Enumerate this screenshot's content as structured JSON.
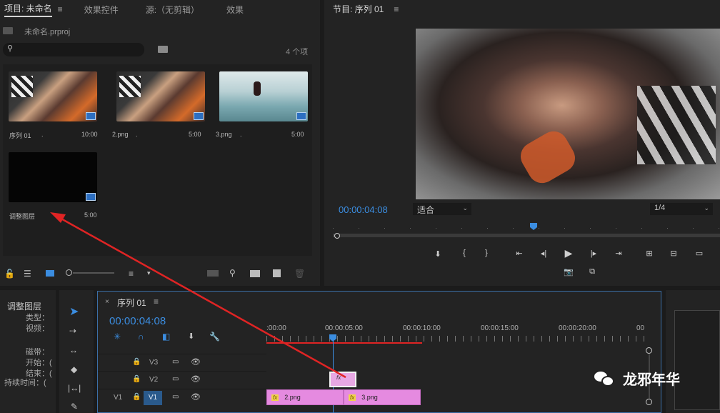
{
  "project_panel": {
    "tabs": [
      {
        "label": "项目: 未命名",
        "active": true
      },
      {
        "label": "效果控件",
        "active": false
      },
      {
        "label": "源:（无剪辑）",
        "active": false
      },
      {
        "label": "效果",
        "active": false
      }
    ],
    "file_name": "未命名.prproj",
    "item_count": "4 个项",
    "items": [
      {
        "name": "序列 01",
        "dot": ".",
        "duration": "10:00"
      },
      {
        "name": "2.png",
        "dot": ".",
        "duration": "5:00"
      },
      {
        "name": "3.png",
        "dot": ".",
        "duration": "5:00"
      },
      {
        "name": "调整图层",
        "dot": "",
        "duration": "5:00"
      }
    ]
  },
  "program_monitor": {
    "title": "节目: 序列 01",
    "timecode": "00:00:04:08",
    "fit_label": "适合",
    "resolution": "1/4",
    "playhead_fraction": 0.51
  },
  "effect_controls_left": {
    "title": "调整图层",
    "labels": [
      "类型：",
      "视频：",
      "磁带：",
      "开始：(",
      "结束：(",
      "持续时间：("
    ]
  },
  "timeline": {
    "title": "序列 01",
    "timecode": "00:00:04:08",
    "ruler_labels": [
      ":00:00",
      "00:00:05:00",
      "00:00:10:00",
      "00:00:15:00",
      "00:00:20:00",
      "00"
    ],
    "tracks": [
      {
        "source": "",
        "name": "V3"
      },
      {
        "source": "",
        "name": "V2"
      },
      {
        "source": "V1",
        "name": "V1"
      }
    ],
    "clips": [
      {
        "label": "2.png",
        "fx": "fx"
      },
      {
        "label": "3.png",
        "fx": "fx"
      }
    ],
    "adjustment_clip_fx": "fx"
  },
  "watermark": "龙邪年华",
  "colors": {
    "accent_blue": "#3b8de0",
    "clip_pink": "#e58ae0",
    "arrow_red": "#e02424"
  }
}
